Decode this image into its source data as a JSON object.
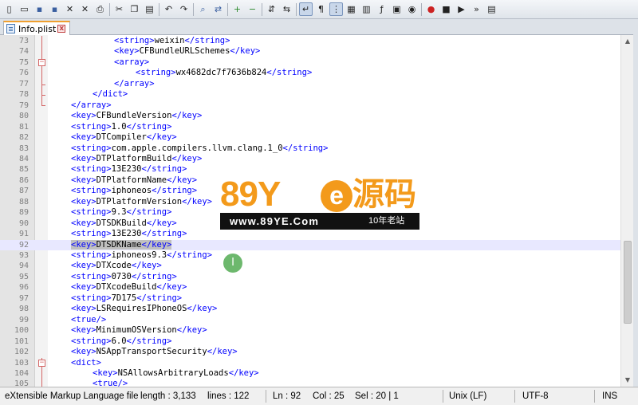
{
  "toolbar": {
    "icons": [
      "new-file-icon",
      "open-file-icon",
      "save-icon",
      "save-all-icon",
      "close-icon",
      "close-all-icon",
      "print-icon",
      "sep",
      "cut-icon",
      "copy-icon",
      "paste-icon",
      "sep",
      "undo-icon",
      "redo-icon",
      "sep",
      "find-icon",
      "replace-icon",
      "sep",
      "zoom-in-icon",
      "zoom-out-icon",
      "sep",
      "sync-vertical-icon",
      "sync-horizontal-icon",
      "sep",
      "word-wrap-icon",
      "show-all-chars-icon",
      "indent-guide-icon",
      "user-language-icon",
      "doc-map-icon",
      "function-list-icon",
      "folder-workspace-icon",
      "monitoring-icon",
      "sep",
      "record-macro-icon",
      "stop-macro-icon",
      "play-macro-icon",
      "run-macro-multiple-icon",
      "save-macro-icon"
    ],
    "glyphs": {
      "new-file-icon": "▯",
      "open-file-icon": "▭",
      "save-icon": "▪",
      "save-all-icon": "▪",
      "close-icon": "✕",
      "close-all-icon": "✕",
      "print-icon": "⎙",
      "cut-icon": "✂",
      "copy-icon": "❐",
      "paste-icon": "▤",
      "undo-icon": "↶",
      "redo-icon": "↷",
      "find-icon": "⌕",
      "replace-icon": "⇄",
      "zoom-in-icon": "+",
      "zoom-out-icon": "−",
      "sync-vertical-icon": "⇵",
      "sync-horizontal-icon": "⇆",
      "word-wrap-icon": "↵",
      "show-all-chars-icon": "¶",
      "indent-guide-icon": "⋮",
      "user-language-icon": "▦",
      "doc-map-icon": "▥",
      "function-list-icon": "ƒ",
      "folder-workspace-icon": "▣",
      "monitoring-icon": "◉",
      "record-macro-icon": "●",
      "stop-macro-icon": "■",
      "play-macro-icon": "▶",
      "run-macro-multiple-icon": "»",
      "save-macro-icon": "▤"
    },
    "active": [
      "word-wrap-icon",
      "indent-guide-icon"
    ]
  },
  "tab": {
    "label": "Info.plist",
    "close_glyph": "x"
  },
  "editor": {
    "current_line": "92",
    "lines": [
      {
        "n": "73",
        "indent": 3,
        "parts": [
          [
            "tag",
            "<string>"
          ],
          [
            "txt",
            "weixin"
          ],
          [
            "tag",
            "</string>"
          ]
        ]
      },
      {
        "n": "74",
        "indent": 3,
        "parts": [
          [
            "tag",
            "<key>"
          ],
          [
            "txt",
            "CFBundleURLSchemes"
          ],
          [
            "tag",
            "</key>"
          ]
        ]
      },
      {
        "n": "75",
        "indent": 3,
        "parts": [
          [
            "tag",
            "<array>"
          ]
        ]
      },
      {
        "n": "76",
        "indent": 4,
        "parts": [
          [
            "tag",
            "<string>"
          ],
          [
            "txt",
            "wx4682dc7f7636b824"
          ],
          [
            "tag",
            "</string>"
          ]
        ]
      },
      {
        "n": "77",
        "indent": 3,
        "parts": [
          [
            "tag",
            "</array>"
          ]
        ]
      },
      {
        "n": "78",
        "indent": 2,
        "parts": [
          [
            "tag",
            "</dict>"
          ]
        ]
      },
      {
        "n": "79",
        "indent": 1,
        "parts": [
          [
            "tag",
            "</array>"
          ]
        ]
      },
      {
        "n": "80",
        "indent": 1,
        "parts": [
          [
            "tag",
            "<key>"
          ],
          [
            "txt",
            "CFBundleVersion"
          ],
          [
            "tag",
            "</key>"
          ]
        ]
      },
      {
        "n": "81",
        "indent": 1,
        "parts": [
          [
            "tag",
            "<string>"
          ],
          [
            "txt",
            "1.0"
          ],
          [
            "tag",
            "</string>"
          ]
        ]
      },
      {
        "n": "82",
        "indent": 1,
        "parts": [
          [
            "tag",
            "<key>"
          ],
          [
            "txt",
            "DTCompiler"
          ],
          [
            "tag",
            "</key>"
          ]
        ]
      },
      {
        "n": "83",
        "indent": 1,
        "parts": [
          [
            "tag",
            "<string>"
          ],
          [
            "txt",
            "com.apple.compilers.llvm.clang.1_0"
          ],
          [
            "tag",
            "</string>"
          ]
        ]
      },
      {
        "n": "84",
        "indent": 1,
        "parts": [
          [
            "tag",
            "<key>"
          ],
          [
            "txt",
            "DTPlatformBuild"
          ],
          [
            "tag",
            "</key>"
          ]
        ]
      },
      {
        "n": "85",
        "indent": 1,
        "parts": [
          [
            "tag",
            "<string>"
          ],
          [
            "txt",
            "13E230"
          ],
          [
            "tag",
            "</string>"
          ]
        ]
      },
      {
        "n": "86",
        "indent": 1,
        "parts": [
          [
            "tag",
            "<key>"
          ],
          [
            "txt",
            "DTPlatformName"
          ],
          [
            "tag",
            "</key>"
          ]
        ]
      },
      {
        "n": "87",
        "indent": 1,
        "parts": [
          [
            "tag",
            "<string>"
          ],
          [
            "txt",
            "iphoneos"
          ],
          [
            "tag",
            "</string>"
          ]
        ]
      },
      {
        "n": "88",
        "indent": 1,
        "parts": [
          [
            "tag",
            "<key>"
          ],
          [
            "txt",
            "DTPlatformVersion"
          ],
          [
            "tag",
            "</key>"
          ]
        ]
      },
      {
        "n": "89",
        "indent": 1,
        "parts": [
          [
            "tag",
            "<string>"
          ],
          [
            "txt",
            "9.3"
          ],
          [
            "tag",
            "</string>"
          ]
        ]
      },
      {
        "n": "90",
        "indent": 1,
        "parts": [
          [
            "tag",
            "<key>"
          ],
          [
            "txt",
            "DTSDKBuild"
          ],
          [
            "tag",
            "</key>"
          ]
        ]
      },
      {
        "n": "91",
        "indent": 1,
        "parts": [
          [
            "tag",
            "<string>"
          ],
          [
            "txt",
            "13E230"
          ],
          [
            "tag",
            "</string>"
          ]
        ]
      },
      {
        "n": "92",
        "indent": 1,
        "parts": [
          [
            "tag",
            "<key>"
          ],
          [
            "txt",
            "DTSDKName"
          ],
          [
            "tag",
            "</key>"
          ]
        ]
      },
      {
        "n": "93",
        "indent": 1,
        "parts": [
          [
            "tag",
            "<string>"
          ],
          [
            "txt",
            "iphoneos9.3"
          ],
          [
            "tag",
            "</string>"
          ]
        ]
      },
      {
        "n": "94",
        "indent": 1,
        "parts": [
          [
            "tag",
            "<key>"
          ],
          [
            "txt",
            "DTXcode"
          ],
          [
            "tag",
            "</key>"
          ]
        ]
      },
      {
        "n": "95",
        "indent": 1,
        "parts": [
          [
            "tag",
            "<string>"
          ],
          [
            "txt",
            "0730"
          ],
          [
            "tag",
            "</string>"
          ]
        ]
      },
      {
        "n": "96",
        "indent": 1,
        "parts": [
          [
            "tag",
            "<key>"
          ],
          [
            "txt",
            "DTXcodeBuild"
          ],
          [
            "tag",
            "</key>"
          ]
        ]
      },
      {
        "n": "97",
        "indent": 1,
        "parts": [
          [
            "tag",
            "<string>"
          ],
          [
            "txt",
            "7D175"
          ],
          [
            "tag",
            "</string>"
          ]
        ]
      },
      {
        "n": "98",
        "indent": 1,
        "parts": [
          [
            "tag",
            "<key>"
          ],
          [
            "txt",
            "LSRequiresIPhoneOS"
          ],
          [
            "tag",
            "</key>"
          ]
        ]
      },
      {
        "n": "99",
        "indent": 1,
        "parts": [
          [
            "tag",
            "<true/>"
          ]
        ]
      },
      {
        "n": "100",
        "indent": 1,
        "parts": [
          [
            "tag",
            "<key>"
          ],
          [
            "txt",
            "MinimumOSVersion"
          ],
          [
            "tag",
            "</key>"
          ]
        ]
      },
      {
        "n": "101",
        "indent": 1,
        "parts": [
          [
            "tag",
            "<string>"
          ],
          [
            "txt",
            "6.0"
          ],
          [
            "tag",
            "</string>"
          ]
        ]
      },
      {
        "n": "102",
        "indent": 1,
        "parts": [
          [
            "tag",
            "<key>"
          ],
          [
            "txt",
            "NSAppTransportSecurity"
          ],
          [
            "tag",
            "</key>"
          ]
        ]
      },
      {
        "n": "103",
        "indent": 1,
        "parts": [
          [
            "tag",
            "<dict>"
          ]
        ]
      },
      {
        "n": "104",
        "indent": 2,
        "parts": [
          [
            "tag",
            "<key>"
          ],
          [
            "txt",
            "NSAllowsArbitraryLoads"
          ],
          [
            "tag",
            "</key>"
          ]
        ]
      },
      {
        "n": "105",
        "indent": 2,
        "parts": [
          [
            "tag",
            "<true/>"
          ]
        ]
      }
    ],
    "selected_text": "<key>DTSDKName</key>"
  },
  "watermark": {
    "brand_num": "89Y",
    "brand_e": "e",
    "brand_cn": "源码",
    "url": "www.89YE.Com",
    "tagline": "10年老站"
  },
  "cursor_glyph": "I",
  "status": {
    "file_type": "eXtensible Markup Language file",
    "length": "length : 3,133",
    "lines": "lines : 122",
    "ln": "Ln : 92",
    "col": "Col : 25",
    "sel": "Sel : 20 | 1",
    "eol": "Unix (LF)",
    "encoding": "UTF-8",
    "mode": "INS"
  },
  "colors": {
    "tag": "#0000ff",
    "text": "#000000",
    "fold": "#d46565",
    "watermark": "#f39a1b"
  }
}
